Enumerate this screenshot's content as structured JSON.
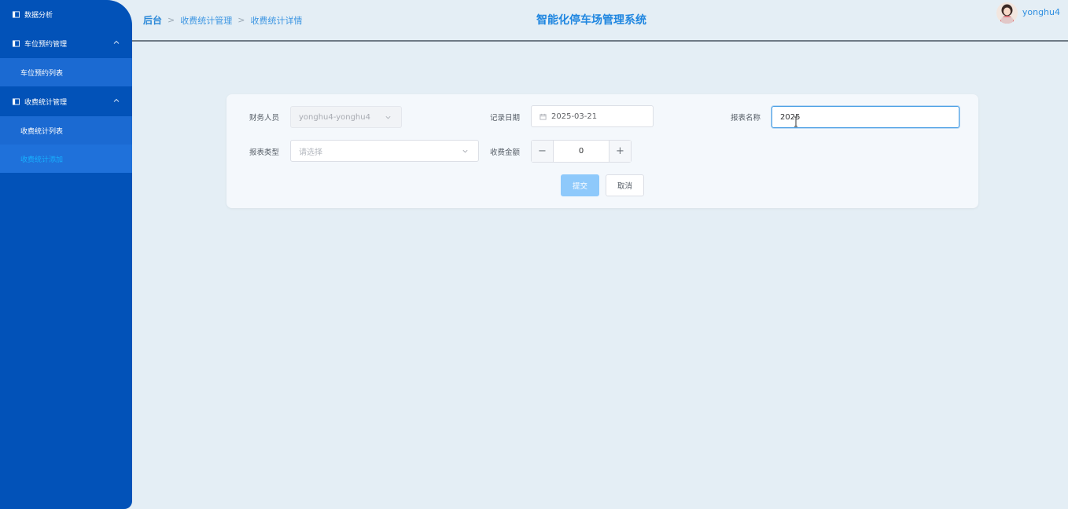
{
  "sidebar": {
    "items": [
      {
        "label": "数据分析"
      },
      {
        "label": "车位预约管理"
      },
      {
        "label": "车位预约列表"
      },
      {
        "label": "收费统计管理"
      },
      {
        "label": "收费统计列表"
      },
      {
        "label": "收费统计添加"
      }
    ]
  },
  "header": {
    "breadcrumb": [
      "后台",
      "收费统计管理",
      "收费统计详情"
    ],
    "title": "智能化停车场管理系统",
    "username": "yonghu4"
  },
  "form": {
    "finance_staff": {
      "label": "财务人员",
      "value": "yonghu4-yonghu4"
    },
    "record_date": {
      "label": "记录日期",
      "value": "2025-03-21"
    },
    "report_name": {
      "label": "报表名称",
      "value": "2025"
    },
    "report_type": {
      "label": "报表类型",
      "placeholder": "请选择"
    },
    "amount": {
      "label": "收费金额",
      "value": "0",
      "minus": "−",
      "plus": "+"
    },
    "submit_label": "提交",
    "cancel_label": "取消"
  },
  "colors": {
    "sidebar_bg": "#0252b8",
    "accent": "#1f86e0",
    "active_text": "#17b0ff",
    "primary_button": "#8ec9fb"
  }
}
